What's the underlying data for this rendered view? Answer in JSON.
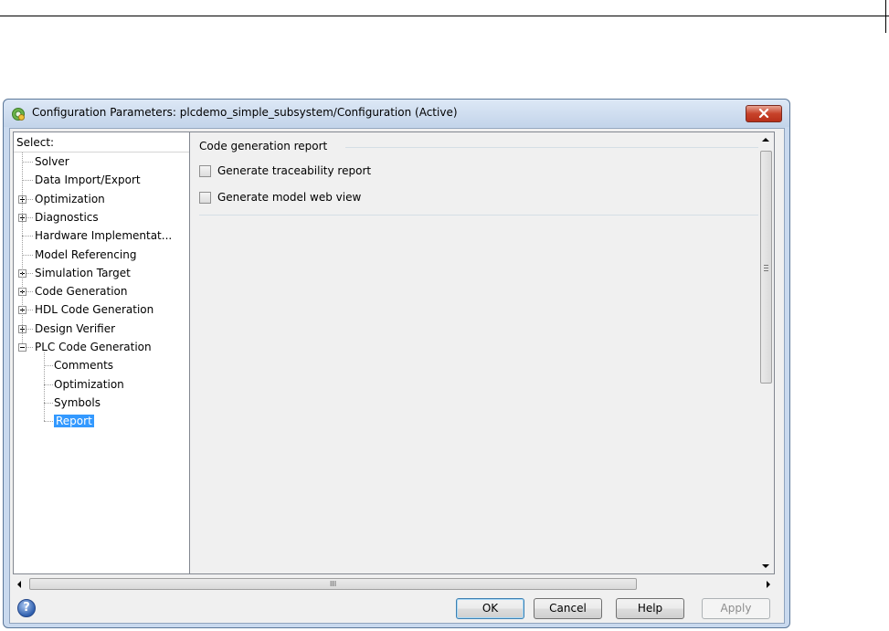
{
  "window": {
    "title": "Configuration Parameters: plcdemo_simple_subsystem/Configuration (Active)"
  },
  "tree": {
    "header": "Select:",
    "items": [
      {
        "label": "Solver",
        "level": 0,
        "expander": "none",
        "selected": false
      },
      {
        "label": "Data Import/Export",
        "level": 0,
        "expander": "none",
        "selected": false
      },
      {
        "label": "Optimization",
        "level": 0,
        "expander": "plus",
        "selected": false
      },
      {
        "label": "Diagnostics",
        "level": 0,
        "expander": "plus",
        "selected": false
      },
      {
        "label": "Hardware Implementat...",
        "level": 0,
        "expander": "none",
        "selected": false
      },
      {
        "label": "Model Referencing",
        "level": 0,
        "expander": "none",
        "selected": false
      },
      {
        "label": "Simulation Target",
        "level": 0,
        "expander": "plus",
        "selected": false
      },
      {
        "label": "Code Generation",
        "level": 0,
        "expander": "plus",
        "selected": false
      },
      {
        "label": "HDL Code Generation",
        "level": 0,
        "expander": "plus",
        "selected": false
      },
      {
        "label": "Design Verifier",
        "level": 0,
        "expander": "plus",
        "selected": false
      },
      {
        "label": "PLC Code Generation",
        "level": 0,
        "expander": "minus",
        "selected": false
      },
      {
        "label": "Comments",
        "level": 1,
        "expander": "none",
        "selected": false
      },
      {
        "label": "Optimization",
        "level": 1,
        "expander": "none",
        "selected": false
      },
      {
        "label": "Symbols",
        "level": 1,
        "expander": "none",
        "selected": false
      },
      {
        "label": "Report",
        "level": 1,
        "expander": "none",
        "selected": true
      }
    ]
  },
  "content": {
    "group_title": "Code generation report",
    "options": [
      {
        "label": "Generate traceability report",
        "checked": false
      },
      {
        "label": "Generate model web view",
        "checked": false
      }
    ]
  },
  "scrollbar": {
    "grip": "III"
  },
  "buttons": {
    "ok": "OK",
    "cancel": "Cancel",
    "help": "Help",
    "apply": "Apply"
  },
  "help_icon": {
    "glyph": "?"
  },
  "colors": {
    "selection": "#3399ff",
    "titlebar": "#c9d9ee",
    "close_button": "#c7422a"
  }
}
